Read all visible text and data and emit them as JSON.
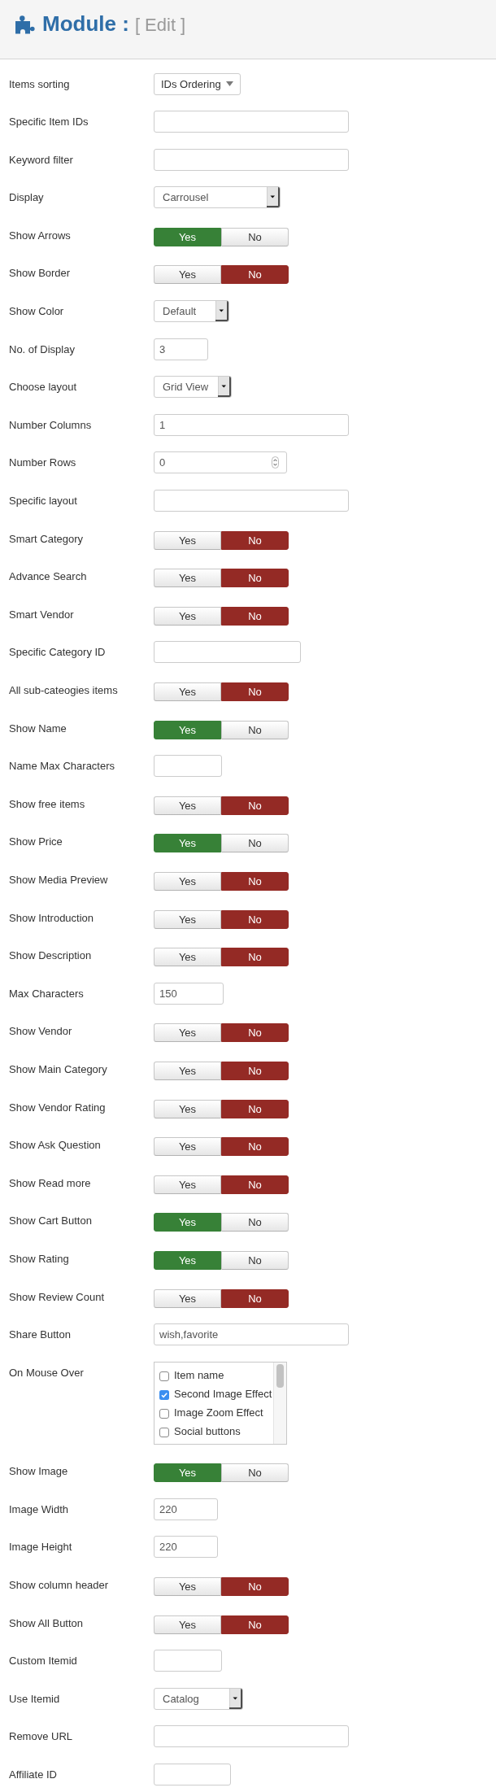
{
  "header": {
    "title": "Module :",
    "subtitle": "[ Edit ]"
  },
  "fields": [
    {
      "label": "Items sorting",
      "kind": "dropdown",
      "value": "IDs Ordering"
    },
    {
      "label": "Specific Item IDs",
      "kind": "text"
    },
    {
      "label": "Keyword filter",
      "kind": "text"
    },
    {
      "label": "Display",
      "kind": "select",
      "value": "Carrousel"
    },
    {
      "label": "Show Arrows",
      "kind": "toggle",
      "options": [
        {
          "label": "Yes",
          "selected": true
        },
        {
          "label": "No",
          "selected": false
        }
      ]
    },
    {
      "label": "Show Border",
      "kind": "toggle",
      "options": [
        {
          "label": "Yes",
          "selected": false
        },
        {
          "label": "No",
          "selected": true
        }
      ]
    },
    {
      "label": "Show Color",
      "kind": "select",
      "value": "Default"
    },
    {
      "label": "No. of Display",
      "kind": "text",
      "value": "3"
    },
    {
      "label": "Choose layout",
      "kind": "select",
      "value": "Grid View"
    },
    {
      "label": "Number Columns",
      "kind": "text",
      "value": "1"
    },
    {
      "label": "Number Rows",
      "kind": "number",
      "value": "0"
    },
    {
      "label": "Specific layout",
      "kind": "text"
    },
    {
      "label": "Smart Category",
      "kind": "toggle",
      "options": [
        {
          "label": "Yes",
          "selected": false
        },
        {
          "label": "No",
          "selected": true
        }
      ]
    },
    {
      "label": "Advance Search",
      "kind": "toggle",
      "options": [
        {
          "label": "Yes",
          "selected": false
        },
        {
          "label": "No",
          "selected": true
        }
      ]
    },
    {
      "label": "Smart Vendor",
      "kind": "toggle",
      "options": [
        {
          "label": "Yes",
          "selected": false
        },
        {
          "label": "No",
          "selected": true
        }
      ]
    },
    {
      "label": "Specific Category ID",
      "kind": "text"
    },
    {
      "label": "All sub-cateogies items",
      "kind": "toggle",
      "options": [
        {
          "label": "Yes",
          "selected": false
        },
        {
          "label": "No",
          "selected": true
        }
      ]
    },
    {
      "label": "Show Name",
      "kind": "toggle",
      "options": [
        {
          "label": "Yes",
          "selected": true
        },
        {
          "label": "No",
          "selected": false
        }
      ]
    },
    {
      "label": "Name Max Characters",
      "kind": "text"
    },
    {
      "label": "Show free items",
      "kind": "toggle",
      "options": [
        {
          "label": "Yes",
          "selected": false
        },
        {
          "label": "No",
          "selected": true
        }
      ]
    },
    {
      "label": "Show Price",
      "kind": "toggle",
      "options": [
        {
          "label": "Yes",
          "selected": true
        },
        {
          "label": "No",
          "selected": false
        }
      ]
    },
    {
      "label": "Show Media Preview",
      "kind": "toggle",
      "options": [
        {
          "label": "Yes",
          "selected": false
        },
        {
          "label": "No",
          "selected": true
        }
      ]
    },
    {
      "label": "Show Introduction",
      "kind": "toggle",
      "options": [
        {
          "label": "Yes",
          "selected": false
        },
        {
          "label": "No",
          "selected": true
        }
      ]
    },
    {
      "label": "Show Description",
      "kind": "toggle",
      "options": [
        {
          "label": "Yes",
          "selected": false
        },
        {
          "label": "No",
          "selected": true
        }
      ]
    },
    {
      "label": "Max Characters",
      "kind": "text",
      "value": "150"
    },
    {
      "label": "Show Vendor",
      "kind": "toggle",
      "options": [
        {
          "label": "Yes",
          "selected": false
        },
        {
          "label": "No",
          "selected": true
        }
      ]
    },
    {
      "label": "Show Main Category",
      "kind": "toggle",
      "options": [
        {
          "label": "Yes",
          "selected": false
        },
        {
          "label": "No",
          "selected": true
        }
      ]
    },
    {
      "label": "Show Vendor Rating",
      "kind": "toggle",
      "options": [
        {
          "label": "Yes",
          "selected": false
        },
        {
          "label": "No",
          "selected": true
        }
      ]
    },
    {
      "label": "Show Ask Question",
      "kind": "toggle",
      "options": [
        {
          "label": "Yes",
          "selected": false
        },
        {
          "label": "No",
          "selected": true
        }
      ]
    },
    {
      "label": "Show Read more",
      "kind": "toggle",
      "options": [
        {
          "label": "Yes",
          "selected": false
        },
        {
          "label": "No",
          "selected": true
        }
      ]
    },
    {
      "label": "Show Cart Button",
      "kind": "toggle",
      "options": [
        {
          "label": "Yes",
          "selected": true
        },
        {
          "label": "No",
          "selected": false
        }
      ]
    },
    {
      "label": "Show Rating",
      "kind": "toggle",
      "options": [
        {
          "label": "Yes",
          "selected": true
        },
        {
          "label": "No",
          "selected": false
        }
      ]
    },
    {
      "label": "Show Review Count",
      "kind": "toggle",
      "options": [
        {
          "label": "Yes",
          "selected": false
        },
        {
          "label": "No",
          "selected": true
        }
      ]
    },
    {
      "label": "Share Button",
      "kind": "text",
      "value": "wish,favorite"
    },
    {
      "label": "On Mouse Over",
      "kind": "checklist",
      "items": [
        {
          "label": "Item name",
          "checked": false
        },
        {
          "label": "Second Image Effect",
          "checked": true
        },
        {
          "label": "Image Zoom Effect",
          "checked": false
        },
        {
          "label": "Social buttons",
          "checked": false
        }
      ]
    },
    {
      "label": "Show Image",
      "kind": "toggle",
      "options": [
        {
          "label": "Yes",
          "selected": true
        },
        {
          "label": "No",
          "selected": false
        }
      ]
    },
    {
      "label": "Image Width",
      "kind": "text",
      "value": "220"
    },
    {
      "label": "Image Height",
      "kind": "text",
      "value": "220"
    },
    {
      "label": "Show column header",
      "kind": "toggle",
      "options": [
        {
          "label": "Yes",
          "selected": false
        },
        {
          "label": "No",
          "selected": true
        }
      ]
    },
    {
      "label": "Show All Button",
      "kind": "toggle",
      "options": [
        {
          "label": "Yes",
          "selected": false
        },
        {
          "label": "No",
          "selected": true
        }
      ]
    },
    {
      "label": "Custom Itemid",
      "kind": "text"
    },
    {
      "label": "Use Itemid",
      "kind": "select",
      "value": "Catalog"
    },
    {
      "label": "Remove URL",
      "kind": "text"
    },
    {
      "label": "Affiliate ID",
      "kind": "text"
    }
  ]
}
